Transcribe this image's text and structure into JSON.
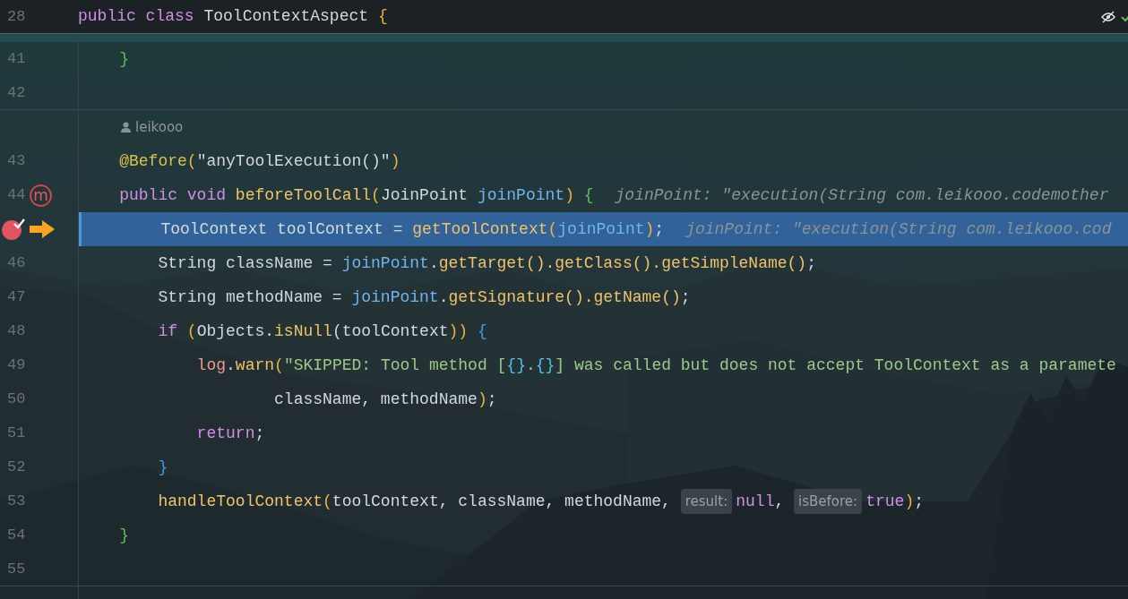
{
  "sticky_header": {
    "number": "28",
    "tokens": [
      {
        "t": "public class ",
        "kind": "kw"
      },
      {
        "t": "ToolContextAspect ",
        "kind": "plain"
      },
      {
        "t": "{",
        "kind": "brace-yellow"
      }
    ]
  },
  "top_icons": [
    {
      "kind": "eye-off"
    },
    {
      "kind": "check"
    }
  ],
  "rows": [
    {
      "kind": "code",
      "number": "41",
      "selected": false,
      "segments": [
        {
          "kind": "code",
          "tokens": [
            {
              "t": "    }",
              "kind": "brace-green"
            }
          ]
        }
      ]
    },
    {
      "kind": "code",
      "number": "42",
      "selected": false,
      "separator": true,
      "segments": []
    },
    {
      "kind": "author",
      "text": "leikooo"
    },
    {
      "kind": "code",
      "number": "43",
      "selected": false,
      "segments": [
        {
          "kind": "code",
          "tokens": [
            {
              "t": "    @Before",
              "kind": "annotation"
            },
            {
              "t": "(",
              "kind": "paren"
            },
            {
              "t": "\"anyToolExecution()\"",
              "kind": "plain"
            },
            {
              "t": ")",
              "kind": "paren"
            }
          ]
        }
      ]
    },
    {
      "kind": "code",
      "number": "44",
      "selected": false,
      "gutter_icon": {
        "kind": "method-breakpoint",
        "label": "m"
      },
      "segments": [
        {
          "kind": "code",
          "tokens": [
            {
              "t": "    public void ",
              "kind": "kw"
            },
            {
              "t": "beforeToolCall",
              "kind": "fn"
            },
            {
              "t": "(",
              "kind": "paren"
            },
            {
              "t": "JoinPoint ",
              "kind": "plain"
            },
            {
              "t": "joinPoint",
              "kind": "param"
            },
            {
              "t": ") ",
              "kind": "paren"
            },
            {
              "t": "{",
              "kind": "brace-green"
            }
          ]
        },
        {
          "kind": "hint",
          "text": "joinPoint: \"execution(String com.leikooo.codemother"
        }
      ]
    },
    {
      "kind": "code",
      "selected": true,
      "gutter_icon": {
        "kind": "breakpoint-hit"
      },
      "execution_point": true,
      "segments": [
        {
          "kind": "code",
          "tokens": [
            {
              "t": "        ToolContext toolContext = ",
              "kind": "plain"
            },
            {
              "t": "getToolContext",
              "kind": "fn"
            },
            {
              "t": "(",
              "kind": "paren"
            },
            {
              "t": "joinPoint",
              "kind": "param"
            },
            {
              "t": ")",
              "kind": "paren"
            },
            {
              "t": ";",
              "kind": "plain"
            }
          ]
        },
        {
          "kind": "hint",
          "text": "joinPoint: \"execution(String com.leikooo.cod"
        }
      ]
    },
    {
      "kind": "code",
      "number": "46",
      "selected": false,
      "segments": [
        {
          "kind": "code",
          "tokens": [
            {
              "t": "        String className = ",
              "kind": "plain"
            },
            {
              "t": "joinPoint",
              "kind": "param"
            },
            {
              "t": ".",
              "kind": "plain"
            },
            {
              "t": "getTarget().",
              "kind": "fn"
            },
            {
              "t": "getClass().",
              "kind": "fn"
            },
            {
              "t": "getSimpleName()",
              "kind": "fn"
            },
            {
              "t": ";",
              "kind": "plain"
            }
          ]
        }
      ]
    },
    {
      "kind": "code",
      "number": "47",
      "selected": false,
      "segments": [
        {
          "kind": "code",
          "tokens": [
            {
              "t": "        String methodName = ",
              "kind": "plain"
            },
            {
              "t": "joinPoint",
              "kind": "param"
            },
            {
              "t": ".",
              "kind": "plain"
            },
            {
              "t": "getSignature().",
              "kind": "fn"
            },
            {
              "t": "getName()",
              "kind": "fn"
            },
            {
              "t": ";",
              "kind": "plain"
            }
          ]
        }
      ]
    },
    {
      "kind": "code",
      "number": "48",
      "selected": false,
      "segments": [
        {
          "kind": "code",
          "tokens": [
            {
              "t": "        if ",
              "kind": "kw"
            },
            {
              "t": "(",
              "kind": "paren"
            },
            {
              "t": "Objects.",
              "kind": "plain"
            },
            {
              "t": "isNull",
              "kind": "fn"
            },
            {
              "t": "(",
              "kind": "plain"
            },
            {
              "t": "toolContext",
              "kind": "plain"
            },
            {
              "t": ")) ",
              "kind": "paren"
            },
            {
              "t": "{",
              "kind": "brace-blue"
            }
          ]
        }
      ]
    },
    {
      "kind": "code",
      "number": "49",
      "selected": false,
      "segments": [
        {
          "kind": "code",
          "tokens": [
            {
              "t": "            log",
              "kind": "field"
            },
            {
              "t": ".",
              "kind": "plain"
            },
            {
              "t": "warn",
              "kind": "fn"
            },
            {
              "t": "(",
              "kind": "paren"
            },
            {
              "t": "\"SKIPPED: Tool method [",
              "kind": "str"
            },
            {
              "t": "{}",
              "kind": "esc"
            },
            {
              "t": ".",
              "kind": "str"
            },
            {
              "t": "{}",
              "kind": "esc"
            },
            {
              "t": "] was called but does not accept ToolContext as a paramete",
              "kind": "str"
            }
          ]
        }
      ]
    },
    {
      "kind": "code",
      "number": "50",
      "selected": false,
      "segments": [
        {
          "kind": "code",
          "tokens": [
            {
              "t": "                    className, methodName",
              "kind": "plain"
            },
            {
              "t": ")",
              "kind": "paren"
            },
            {
              "t": ";",
              "kind": "plain"
            }
          ]
        }
      ]
    },
    {
      "kind": "code",
      "number": "51",
      "selected": false,
      "segments": [
        {
          "kind": "code",
          "tokens": [
            {
              "t": "            return",
              "kind": "kw"
            },
            {
              "t": ";",
              "kind": "plain"
            }
          ]
        }
      ]
    },
    {
      "kind": "code",
      "number": "52",
      "selected": false,
      "segments": [
        {
          "kind": "code",
          "tokens": [
            {
              "t": "        }",
              "kind": "brace-blue"
            }
          ]
        }
      ]
    },
    {
      "kind": "code",
      "number": "53",
      "selected": false,
      "segments": [
        {
          "kind": "code",
          "tokens": [
            {
              "t": "        handleToolContext",
              "kind": "fn"
            },
            {
              "t": "(",
              "kind": "paren"
            },
            {
              "t": "toolContext, className, methodName, ",
              "kind": "plain"
            }
          ]
        },
        {
          "kind": "chip",
          "text": "result:"
        },
        {
          "kind": "code",
          "tokens": [
            {
              "t": "null",
              "kind": "kw"
            },
            {
              "t": ", ",
              "kind": "plain"
            }
          ]
        },
        {
          "kind": "chip",
          "text": "isBefore:"
        },
        {
          "kind": "code",
          "tokens": [
            {
              "t": "true",
              "kind": "kw"
            },
            {
              "t": ")",
              "kind": "paren"
            },
            {
              "t": ";",
              "kind": "plain"
            }
          ]
        }
      ]
    },
    {
      "kind": "code",
      "number": "54",
      "selected": false,
      "segments": [
        {
          "kind": "code",
          "tokens": [
            {
              "t": "    }",
              "kind": "brace-green"
            }
          ]
        }
      ]
    },
    {
      "kind": "code",
      "number": "55",
      "selected": false,
      "separator": true,
      "segments": []
    }
  ]
}
